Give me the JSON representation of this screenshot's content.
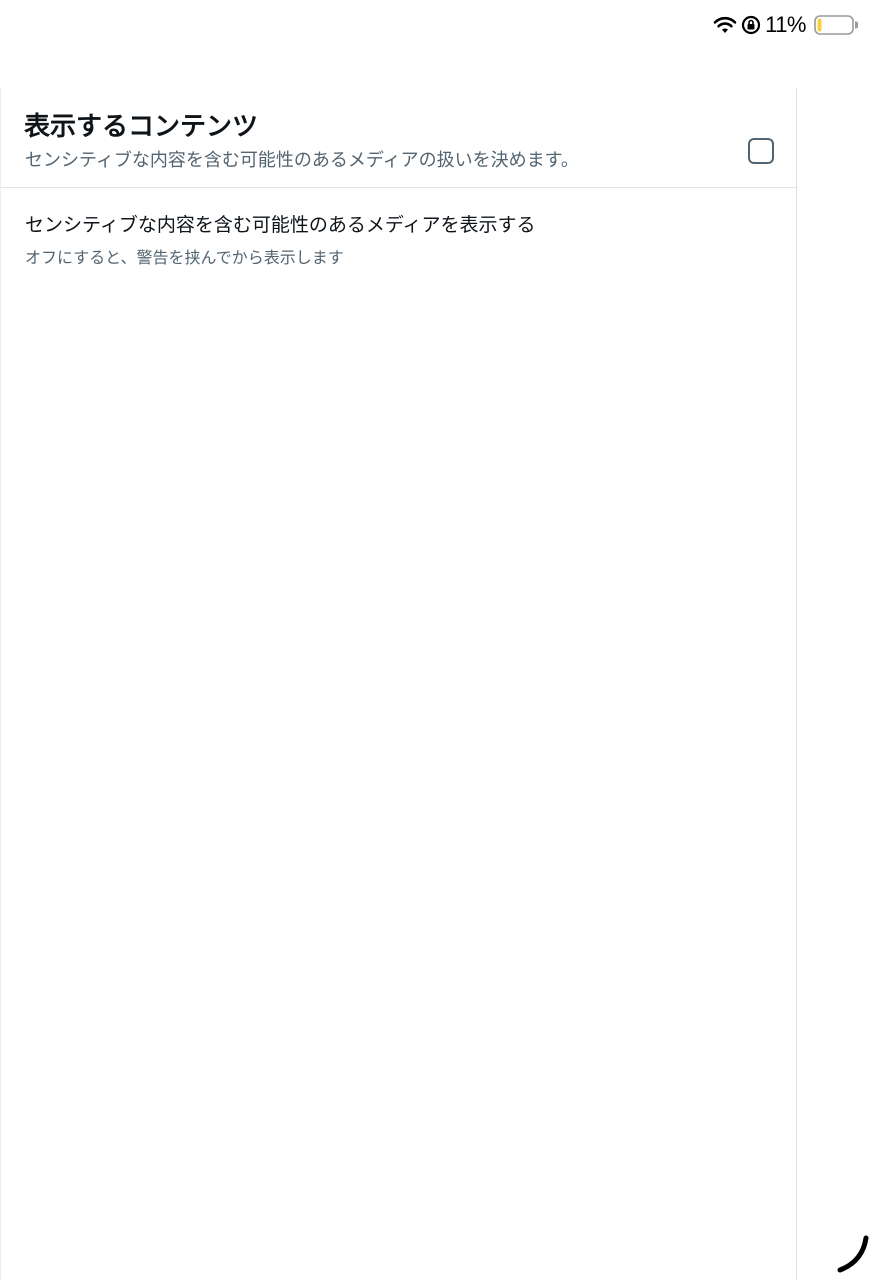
{
  "status_bar": {
    "battery_percent": "11%",
    "battery_level": 0.11,
    "battery_color": "#f4d03f",
    "icons": [
      "wifi-icon",
      "rotation-lock-icon",
      "battery-icon"
    ]
  },
  "header": {
    "title": "表示するコンテンツ",
    "subtitle": "センシティブな内容を含む可能性のあるメディアの扱いを決めます。"
  },
  "settings": [
    {
      "label": "センシティブな内容を含む可能性のあるメディアを表示する",
      "help": "オフにすると、警告を挟んでから表示します",
      "checked": false
    }
  ],
  "colors": {
    "primary_text": "#0f1419",
    "secondary_text": "#536471",
    "divider": "#e4e7ea"
  }
}
